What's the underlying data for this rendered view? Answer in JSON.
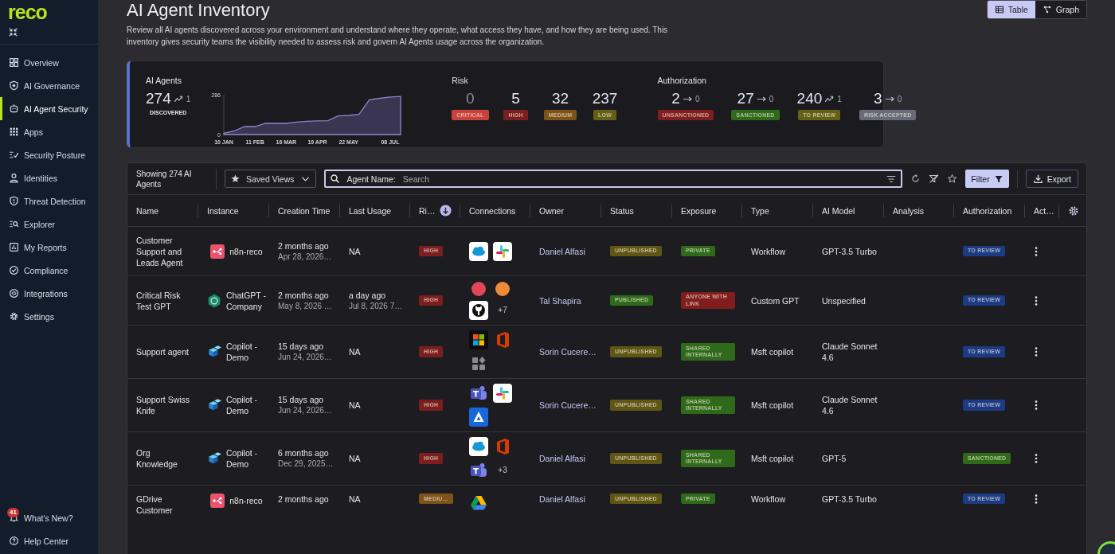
{
  "sidebar": {
    "logo": "reco",
    "items": [
      {
        "label": "Overview",
        "kind": "overview",
        "selected": false
      },
      {
        "label": "AI Governance",
        "kind": "governance",
        "selected": false
      },
      {
        "label": "AI Agent Security",
        "kind": "agent",
        "selected": true
      },
      {
        "label": "Apps",
        "kind": "apps",
        "selected": false
      },
      {
        "label": "Security Posture",
        "kind": "posture",
        "selected": false
      },
      {
        "label": "Identities",
        "kind": "identities",
        "selected": false
      },
      {
        "label": "Threat Detection",
        "kind": "threat",
        "selected": false
      },
      {
        "label": "Explorer",
        "kind": "explorer",
        "selected": false
      },
      {
        "label": "My Reports",
        "kind": "reports",
        "selected": false
      },
      {
        "label": "Compliance",
        "kind": "compliance",
        "selected": false
      },
      {
        "label": "Integrations",
        "kind": "integrations",
        "selected": false
      },
      {
        "label": "Settings",
        "kind": "settings",
        "selected": false
      }
    ],
    "footer": [
      {
        "label": "What's New?",
        "kind": "bell",
        "badge": "41"
      },
      {
        "label": "Help Center",
        "kind": "help"
      }
    ]
  },
  "page": {
    "title": "AI Agent Inventory",
    "description": "Review all AI agents discovered across your environment and understand where they operate, what access they have, and how they are being used. This inventory gives security teams the visibility needed to assess risk and govern AI Agents usage across the organization.",
    "views": [
      {
        "label": "Table",
        "kind": "table",
        "selected": true
      },
      {
        "label": "Graph",
        "kind": "graph",
        "selected": false
      }
    ]
  },
  "summary": {
    "agents": {
      "title": "AI Agents",
      "value": "274",
      "kind": "up",
      "delta": "1",
      "label": "DISCOVERED",
      "chart_data": {
        "type": "area",
        "categories": [
          "10 JAN",
          null,
          null,
          "11 FEB",
          null,
          null,
          "16 MAR",
          null,
          null,
          "19 APR",
          null,
          null,
          "22 MAY",
          null,
          null,
          null,
          "08 JUL",
          null
        ],
        "values": [
          10,
          25,
          57,
          57,
          80,
          80,
          80,
          90,
          95,
          98,
          99,
          133,
          137,
          145,
          250,
          260,
          270,
          274
        ],
        "ylim": [
          0,
          286
        ],
        "yticks": [
          0,
          286
        ]
      }
    },
    "risk": {
      "title": "Risk",
      "items": [
        {
          "value": "0",
          "label": "CRITICAL",
          "color": "#c8423a",
          "muted": true
        },
        {
          "value": "5",
          "label": "HIGH",
          "color": "#7c1e1e",
          "muted": false
        },
        {
          "value": "32",
          "label": "MEDIUM",
          "color": "#7e5218",
          "muted": false
        },
        {
          "value": "237",
          "label": "LOW",
          "color": "#666016",
          "muted": false
        }
      ]
    },
    "authorization": {
      "title": "Authorization",
      "items": [
        {
          "value": "2",
          "kind": "flat",
          "delta": "0",
          "label": "UNSANCTIONED",
          "color": "#821d1d"
        },
        {
          "value": "27",
          "kind": "flat",
          "delta": "0",
          "label": "SANCTIONED",
          "color": "#2e6a19"
        },
        {
          "value": "240",
          "kind": "up",
          "delta": "1",
          "label": "TO REVIEW",
          "color": "#666016"
        },
        {
          "value": "3",
          "kind": "flat",
          "delta": "0",
          "label": "RISK ACCEPTED",
          "color": "#696c78"
        }
      ]
    }
  },
  "table": {
    "toolbar": {
      "count": "Showing 274 AI Agents",
      "saved_views": "Saved Views",
      "search_label": "Agent Name:",
      "placeholder": "Search",
      "filter": "Filter",
      "export": "Export"
    },
    "columns": [
      {
        "label": "Name",
        "sorted": false
      },
      {
        "label": "Instance",
        "sorted": false
      },
      {
        "label": "Creation Time",
        "sorted": false
      },
      {
        "label": "Last Usage",
        "sorted": false
      },
      {
        "label": "Ri…",
        "sorted": true
      },
      {
        "label": "Connections",
        "sorted": false
      },
      {
        "label": "Owner",
        "sorted": false
      },
      {
        "label": "Status",
        "sorted": false
      },
      {
        "label": "Exposure",
        "sorted": false
      },
      {
        "label": "Type",
        "sorted": false
      },
      {
        "label": "AI Model",
        "sorted": false
      },
      {
        "label": "Analysis",
        "sorted": false
      },
      {
        "label": "Authorization",
        "sorted": false
      },
      {
        "label": "Act…",
        "sorted": false
      }
    ],
    "rows": [
      {
        "name": "Customer Support and Leads Agent",
        "instance": {
          "kind": "workflow",
          "label": "n8n-reco"
        },
        "created": "2 months ago",
        "created_date": "Apr 28, 2026…",
        "last_usage": "NA",
        "risk": {
          "text": "HIGH",
          "color": "#7c1e1e"
        },
        "connections": [
          {
            "kind": "cloud"
          },
          {
            "kind": "pinwheel"
          }
        ],
        "owner": "Daniel Alfasi",
        "status": {
          "text": "UNPUBLISHED",
          "color": "#5f5514"
        },
        "exposure": {
          "text": "PRIVATE",
          "color": "#2e6a19"
        },
        "type": "Workflow",
        "model": "GPT-3.5 Turbo",
        "authorization": {
          "text": "TO REVIEW",
          "color": "#1d3a85"
        }
      },
      {
        "name": "Critical Risk Test GPT",
        "instance": {
          "kind": "hexagon",
          "label": "ChatGPT - Company"
        },
        "created": "2 months ago",
        "created_date": "May 8, 2026 …",
        "last_usage": "a day ago",
        "last_usage_date": "Jul 8, 2026 7…",
        "risk": {
          "text": "HIGH",
          "color": "#7c1e1e"
        },
        "connections": [
          {
            "kind": "dot",
            "color": "#e0485a"
          },
          {
            "kind": "dot",
            "color": "#f08a3a"
          },
          {
            "kind": "cat"
          }
        ],
        "more": "+7",
        "owner": "Tal Shapira",
        "status": {
          "text": "PUBLISHED",
          "color": "#2e6a19"
        },
        "exposure": {
          "text": "ANYONE WITH LINK",
          "color": "#821d1d"
        },
        "type": "Custom GPT",
        "model": "Unspecified",
        "authorization": {
          "text": "TO REVIEW",
          "color": "#1d3a85"
        }
      },
      {
        "name": "Support agent",
        "instance": {
          "kind": "cubes",
          "label": "Copilot - Demo"
        },
        "created": "15 days ago",
        "created_date": "Jun 24, 2026…",
        "last_usage": "NA",
        "risk": {
          "text": "HIGH",
          "color": "#7c1e1e"
        },
        "connections": [
          {
            "kind": "windows"
          },
          {
            "kind": "office"
          },
          {
            "kind": "blocks"
          }
        ],
        "owner": "Sorin Cucere…",
        "status": {
          "text": "UNPUBLISHED",
          "color": "#5f5514"
        },
        "exposure": {
          "text": "SHARED INTERNALLY",
          "color": "#2e6a19"
        },
        "type": "Msft copilot",
        "model": "Claude Sonnet 4.6",
        "authorization": {
          "text": "TO REVIEW",
          "color": "#1d3a85"
        }
      },
      {
        "name": "Support Swiss Knife",
        "instance": {
          "kind": "cubes",
          "label": "Copilot - Demo"
        },
        "created": "15 days ago",
        "created_date": "Jun 24, 2026…",
        "last_usage": "NA",
        "risk": {
          "text": "HIGH",
          "color": "#7c1e1e"
        },
        "connections": [
          {
            "kind": "team"
          },
          {
            "kind": "pinwheel"
          },
          {
            "kind": "triangle"
          }
        ],
        "owner": "Sorin Cucere…",
        "status": {
          "text": "UNPUBLISHED",
          "color": "#5f5514"
        },
        "exposure": {
          "text": "SHARED INTERNALLY",
          "color": "#2e6a19"
        },
        "type": "Msft copilot",
        "model": "Claude Sonnet 4.6",
        "authorization": {
          "text": "TO REVIEW",
          "color": "#1d3a85"
        }
      },
      {
        "name": "Org Knowledge",
        "instance": {
          "kind": "cubes",
          "label": "Copilot - Demo"
        },
        "created": "6 months ago",
        "created_date": "Dec 29, 2025…",
        "last_usage": "NA",
        "risk": {
          "text": "HIGH",
          "color": "#7c1e1e"
        },
        "connections": [
          {
            "kind": "cloud"
          },
          {
            "kind": "office"
          },
          {
            "kind": "team"
          }
        ],
        "more": "+3",
        "owner": "Daniel Alfasi",
        "status": {
          "text": "UNPUBLISHED",
          "color": "#5f5514"
        },
        "exposure": {
          "text": "SHARED INTERNALLY",
          "color": "#2e6a19"
        },
        "type": "Msft copilot",
        "model": "GPT-5",
        "authorization": {
          "text": "SANCTIONED",
          "color": "#2e6a19"
        }
      },
      {
        "name": "GDrive Customer",
        "instance": {
          "kind": "workflow",
          "label": "n8n-reco"
        },
        "created": "2 months ago",
        "last_usage": "NA",
        "risk": {
          "text": "MEDIU…",
          "color": "#7e5218"
        },
        "connections": [
          {
            "kind": "drive"
          }
        ],
        "owner": "Daniel Alfasi",
        "status": {
          "text": "UNPUBLISHED",
          "color": "#5f5514"
        },
        "exposure": {
          "text": "PRIVATE",
          "color": "#2e6a19"
        },
        "type": "Workflow",
        "model": "GPT-3.5 Turbo",
        "authorization": {
          "text": "TO REVIEW",
          "color": "#1d3a85"
        }
      }
    ]
  }
}
